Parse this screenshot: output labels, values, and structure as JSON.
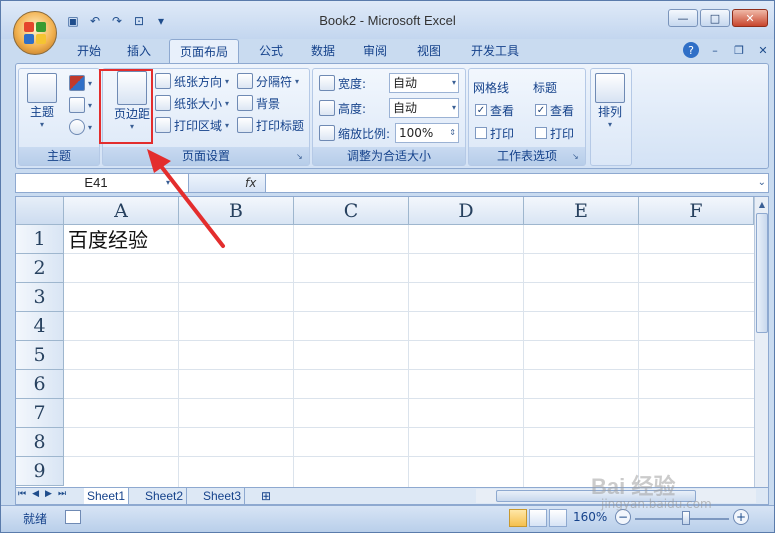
{
  "window": {
    "title": "Book2 - Microsoft Excel",
    "controls": [
      "—",
      "□",
      "✕"
    ]
  },
  "qat": [
    "save-icon",
    "undo-icon",
    "redo-icon",
    "preview-icon",
    "customize-icon"
  ],
  "tabs": [
    "开始",
    "插入",
    "页面布局",
    "公式",
    "数据",
    "审阅",
    "视图",
    "开发工具"
  ],
  "active_tab": "页面布局",
  "ribbon": {
    "theme": {
      "big_label": "主题",
      "group_label": "主题"
    },
    "page_setup": {
      "margins_label": "页边距",
      "orientation_label": "纸张方向",
      "size_label": "纸张大小",
      "print_area_label": "打印区域",
      "breaks_label": "分隔符",
      "background_label": "背景",
      "print_titles_label": "打印标题",
      "group_label": "页面设置"
    },
    "scale": {
      "width_label": "宽度:",
      "width_value": "自动",
      "height_label": "高度:",
      "height_value": "自动",
      "scale_label": "缩放比例:",
      "scale_value": "100%",
      "group_label": "调整为合适大小"
    },
    "sheet_options": {
      "gridlines_label": "网格线",
      "headings_label": "标题",
      "view_label": "查看",
      "print_label": "打印",
      "group_label": "工作表选项",
      "gridlines_view": true,
      "gridlines_print": false,
      "headings_view": true,
      "headings_print": false
    },
    "arrange": {
      "label": "排列"
    }
  },
  "formula_bar": {
    "name_box": "E41",
    "fx": "fx",
    "content": ""
  },
  "columns": [
    "A",
    "B",
    "C",
    "D",
    "E",
    "F"
  ],
  "rows": [
    "1",
    "2",
    "3",
    "4",
    "5",
    "6",
    "7",
    "8",
    "9"
  ],
  "cells": {
    "A1": "百度经验"
  },
  "sheets": [
    "Sheet1",
    "Sheet2",
    "Sheet3"
  ],
  "active_sheet": "Sheet1",
  "status": {
    "ready": "就绪",
    "zoom": "160%"
  },
  "watermark": {
    "brand": "Bai 经验",
    "url": "jingyan.baidu.com"
  },
  "colors": {
    "accent": "#15428b",
    "highlight": "#e32d2d"
  }
}
